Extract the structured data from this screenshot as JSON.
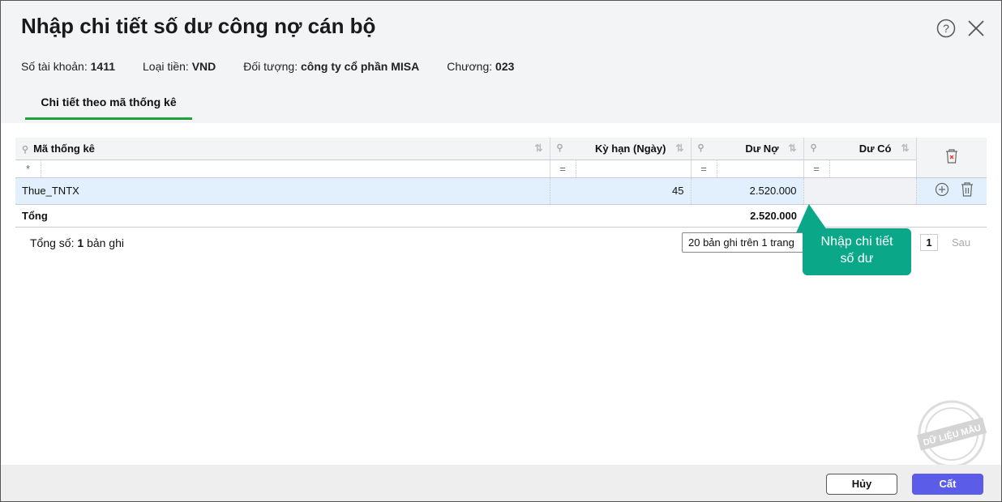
{
  "title": "Nhập chi tiết số dư công nợ cán bộ",
  "info": [
    {
      "label": "Số tài khoản:",
      "value": "1411"
    },
    {
      "label": "Loại tiền:",
      "value": "VND"
    },
    {
      "label": "Đối tượng:",
      "value": "công ty cổ phần MISA"
    },
    {
      "label": "Chương:",
      "value": "023"
    }
  ],
  "tab": "Chi tiết theo mã thống kê",
  "columns": [
    "Mã thống kê",
    "Kỳ hạn (Ngày)",
    "Dư Nợ",
    "Dư Có"
  ],
  "filter": {
    "star": "*",
    "eq": "="
  },
  "rows": [
    {
      "code": "Thue_TNTX",
      "term": "45",
      "debit": "2.520.000",
      "credit": ""
    }
  ],
  "total": {
    "label": "Tổng",
    "debit": "2.520.000"
  },
  "footer": {
    "prefix": "Tổng số:",
    "count": "1",
    "suffix": "bản ghi"
  },
  "pager": {
    "size": "20 bản ghi trên 1 trang",
    "page": "1",
    "next": "Sau"
  },
  "tooltip": "Nhập chi tiết số dư",
  "stamp": "DỮ LIỆU MẪU",
  "buttons": {
    "cancel": "Hủy",
    "save": "Cất"
  },
  "colors": {
    "accent": "#5b5ce8",
    "tab": "#1aa33a",
    "tooltip": "#0aa889",
    "row": "#e1f0fc"
  }
}
